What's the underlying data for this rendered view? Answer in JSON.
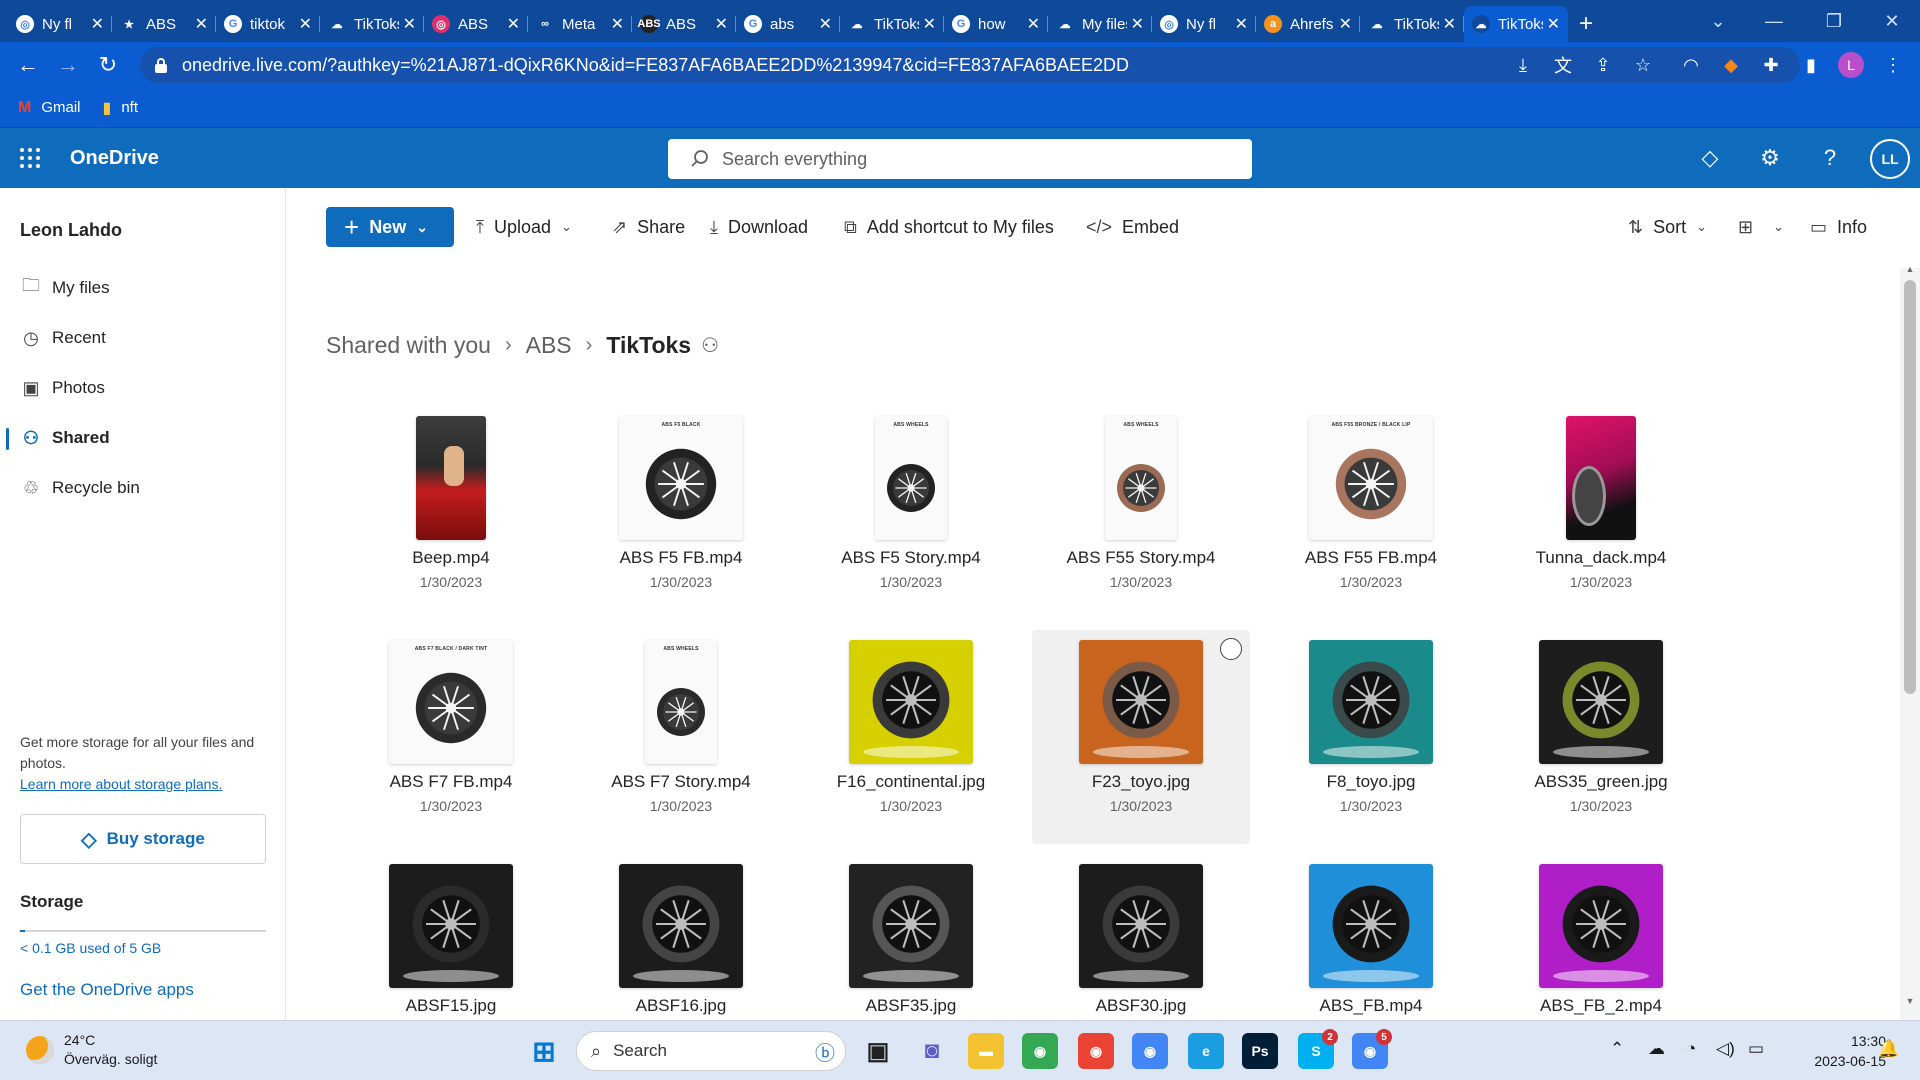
{
  "browser": {
    "tabs": [
      {
        "title": "Ny fl",
        "fav_color": "#ffffff",
        "fav_text": "◎"
      },
      {
        "title": "ABS",
        "fav_color": "#0f4a9a",
        "fav_text": "★"
      },
      {
        "title": "tiktok",
        "fav_color": "#ffffff",
        "fav_text": "G"
      },
      {
        "title": "TikToks",
        "fav_color": "#0f4a9a",
        "fav_text": "☁"
      },
      {
        "title": "ABS",
        "fav_color": "#e1306c",
        "fav_text": "◎"
      },
      {
        "title": "Meta",
        "fav_color": "#0f4a9a",
        "fav_text": "∞"
      },
      {
        "title": "ABS",
        "fav_color": "#222222",
        "fav_text": "ABS"
      },
      {
        "title": "abs",
        "fav_color": "#ffffff",
        "fav_text": "G"
      },
      {
        "title": "TikToks",
        "fav_color": "#0f4a9a",
        "fav_text": "☁"
      },
      {
        "title": "how",
        "fav_color": "#ffffff",
        "fav_text": "G"
      },
      {
        "title": "My files",
        "fav_color": "#0f4a9a",
        "fav_text": "☁"
      },
      {
        "title": "Ny fl",
        "fav_color": "#ffffff",
        "fav_text": "◎"
      },
      {
        "title": "Ahrefs",
        "fav_color": "#f7931e",
        "fav_text": "a"
      },
      {
        "title": "TikToks",
        "fav_color": "#0f4a9a",
        "fav_text": "☁"
      },
      {
        "title": "TikToks",
        "fav_color": "#0f4a9a",
        "fav_text": "☁",
        "active": true
      }
    ],
    "url": "onedrive.live.com/?authkey=%21AJ871-dQixR6KNo&id=FE837AFA6BAEE2DD%2139947&cid=FE837AFA6BAEE2DD",
    "bookmarks": [
      {
        "label": "Gmail",
        "icon": "gmail-icon"
      },
      {
        "label": "nft",
        "icon": "folder-icon"
      }
    ],
    "profile_initial": "L"
  },
  "header": {
    "app_name": "OneDrive",
    "search_placeholder": "Search everything",
    "avatar_initials": "LL"
  },
  "sidebar": {
    "user_name": "Leon Lahdo",
    "items": [
      {
        "label": "My files",
        "icon": "folder-icon"
      },
      {
        "label": "Recent",
        "icon": "clock-icon"
      },
      {
        "label": "Photos",
        "icon": "photo-icon"
      },
      {
        "label": "Shared",
        "icon": "people-icon",
        "active": true
      },
      {
        "label": "Recycle bin",
        "icon": "recycle-bin-icon"
      }
    ],
    "promo_text": "Get more storage for all your files and photos.",
    "promo_link": "Learn more about storage plans.",
    "buy_label": "Buy storage",
    "storage_title": "Storage",
    "storage_used": "< 0.1 GB used of 5 GB",
    "storage_fraction": 0.02,
    "apps_link": "Get the OneDrive apps"
  },
  "commands": {
    "new": "New",
    "upload": "Upload",
    "share": "Share",
    "download": "Download",
    "add_shortcut": "Add shortcut to My files",
    "embed": "Embed",
    "sort": "Sort",
    "info": "Info"
  },
  "breadcrumb": {
    "items": [
      "Shared with you",
      "ABS"
    ],
    "current": "TikToks"
  },
  "files": [
    {
      "name": "Beep.mp4",
      "date": "1/30/2023",
      "thumb": "photo-red",
      "ratio": "tall"
    },
    {
      "name": "ABS F5 FB.mp4",
      "date": "1/30/2023",
      "thumb": "wheel-white",
      "ratio": "square",
      "header": "ABS F5 BLACK",
      "rim": "#222222"
    },
    {
      "name": "ABS F5 Story.mp4",
      "date": "1/30/2023",
      "thumb": "wheel-white",
      "ratio": "story",
      "header": "ABS WHEELS",
      "rim": "#222222"
    },
    {
      "name": "ABS F55 Story.mp4",
      "date": "1/30/2023",
      "thumb": "wheel-white",
      "ratio": "story",
      "header": "ABS WHEELS",
      "rim": "#9a6a55"
    },
    {
      "name": "ABS F55 FB.mp4",
      "date": "1/30/2023",
      "thumb": "wheel-white",
      "ratio": "square",
      "header": "ABS F55 BRONZE / BLACK LIP",
      "rim": "#a8765f"
    },
    {
      "name": "Tunna_dack.mp4",
      "date": "1/30/2023",
      "thumb": "photo-pink",
      "ratio": "tall"
    },
    {
      "name": "ABS F7 FB.mp4",
      "date": "1/30/2023",
      "thumb": "wheel-white",
      "ratio": "square",
      "header": "ABS F7 BLACK / DARK TINT",
      "rim": "#2a2a2a"
    },
    {
      "name": "ABS F7 Story.mp4",
      "date": "1/30/2023",
      "thumb": "wheel-white",
      "ratio": "story",
      "header": "ABS WHEELS",
      "rim": "#2a2a2a"
    },
    {
      "name": "F16_continental.jpg",
      "date": "1/30/2023",
      "thumb": "studio",
      "ratio": "square",
      "bg": "#d6d000",
      "rim": "#3a3a3a"
    },
    {
      "name": "F23_toyo.jpg",
      "date": "1/30/2023",
      "thumb": "studio",
      "ratio": "square",
      "bg": "#c8641e",
      "rim": "#7b5a48",
      "selected": true
    },
    {
      "name": "F8_toyo.jpg",
      "date": "1/30/2023",
      "thumb": "studio",
      "ratio": "square",
      "bg": "#1a8a8a",
      "rim": "#3a4a4a"
    },
    {
      "name": "ABS35_green.jpg",
      "date": "1/30/2023",
      "thumb": "studio",
      "ratio": "square",
      "bg": "#1d1d1d",
      "rim": "#7a8a2a"
    },
    {
      "name": "ABSF15.jpg",
      "date": "",
      "thumb": "studio",
      "ratio": "square",
      "bg": "#1c1c1c",
      "rim": "#2b2b2b"
    },
    {
      "name": "ABSF16.jpg",
      "date": "",
      "thumb": "studio",
      "ratio": "square",
      "bg": "#1c1c1c",
      "rim": "#444444"
    },
    {
      "name": "ABSF35.jpg",
      "date": "",
      "thumb": "studio",
      "ratio": "square",
      "bg": "#222222",
      "rim": "#555555"
    },
    {
      "name": "ABSF30.jpg",
      "date": "",
      "thumb": "studio",
      "ratio": "square",
      "bg": "#1c1c1c",
      "rim": "#3a3a3a"
    },
    {
      "name": "ABS_FB.mp4",
      "date": "",
      "thumb": "studio",
      "ratio": "square",
      "bg": "#1e8fd8",
      "rim": "#1a1a1a"
    },
    {
      "name": "ABS_FB_2.mp4",
      "date": "",
      "thumb": "studio",
      "ratio": "square",
      "bg": "#b01ec8",
      "rim": "#1a1a1a"
    }
  ],
  "taskbar": {
    "weather_temp": "24°C",
    "weather_desc": "Överväg. soligt",
    "search_label": "Search",
    "apps": [
      {
        "name": "file-explorer-icon",
        "color": "#f2c230",
        "text": "▬"
      },
      {
        "name": "chrome-icon",
        "color": "#34a853",
        "text": "◉"
      },
      {
        "name": "chrome-icon",
        "color": "#ea4335",
        "text": "◉"
      },
      {
        "name": "chrome-icon",
        "color": "#4285f4",
        "text": "◉"
      },
      {
        "name": "edge-icon",
        "color": "#1b9de2",
        "text": "e"
      },
      {
        "name": "photoshop-icon",
        "color": "#001e36",
        "text": "Ps"
      },
      {
        "name": "skype-icon",
        "color": "#00aff0",
        "text": "S",
        "badge": "2"
      },
      {
        "name": "chrome-icon",
        "color": "#4285f4",
        "text": "◉",
        "badge": "5"
      }
    ],
    "time": "13:30",
    "date": "2023-06-15"
  }
}
